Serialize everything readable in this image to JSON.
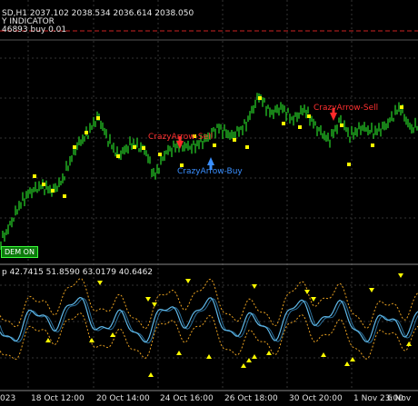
{
  "header": {
    "symbol_line": "SD,H1  2037.102 2038.534 2036.614 2038.050",
    "indicator_line": "Y INDICATOR",
    "trade_line": "46893 buy 0.01"
  },
  "signals": {
    "sell_top": "CrazyArrow-Sell",
    "buy": "CrazyArrow-Buy",
    "sell_right": "CrazyArrow-Sell"
  },
  "status_badge": "DEM ON",
  "subwindow": {
    "values_line": "p 42.7415 51.8590 63.0179 40.6462"
  },
  "time_axis": {
    "labels": [
      "023",
      "18 Oct 12:00",
      "20 Oct 14:00",
      "24 Oct 16:00",
      "26 Oct 18:00",
      "30 Oct 20:00",
      "1 Nov 23:00",
      "6 Nov"
    ]
  },
  "colors": {
    "background": "#000000",
    "price_bars": "#22b822",
    "signal_dots": "#ffff00",
    "sell": "#ff2a2a",
    "buy": "#3a8fff",
    "osc_main": "#5fb8e8",
    "osc_bands": "#e8a020",
    "grid": "#3a3a3a"
  }
}
